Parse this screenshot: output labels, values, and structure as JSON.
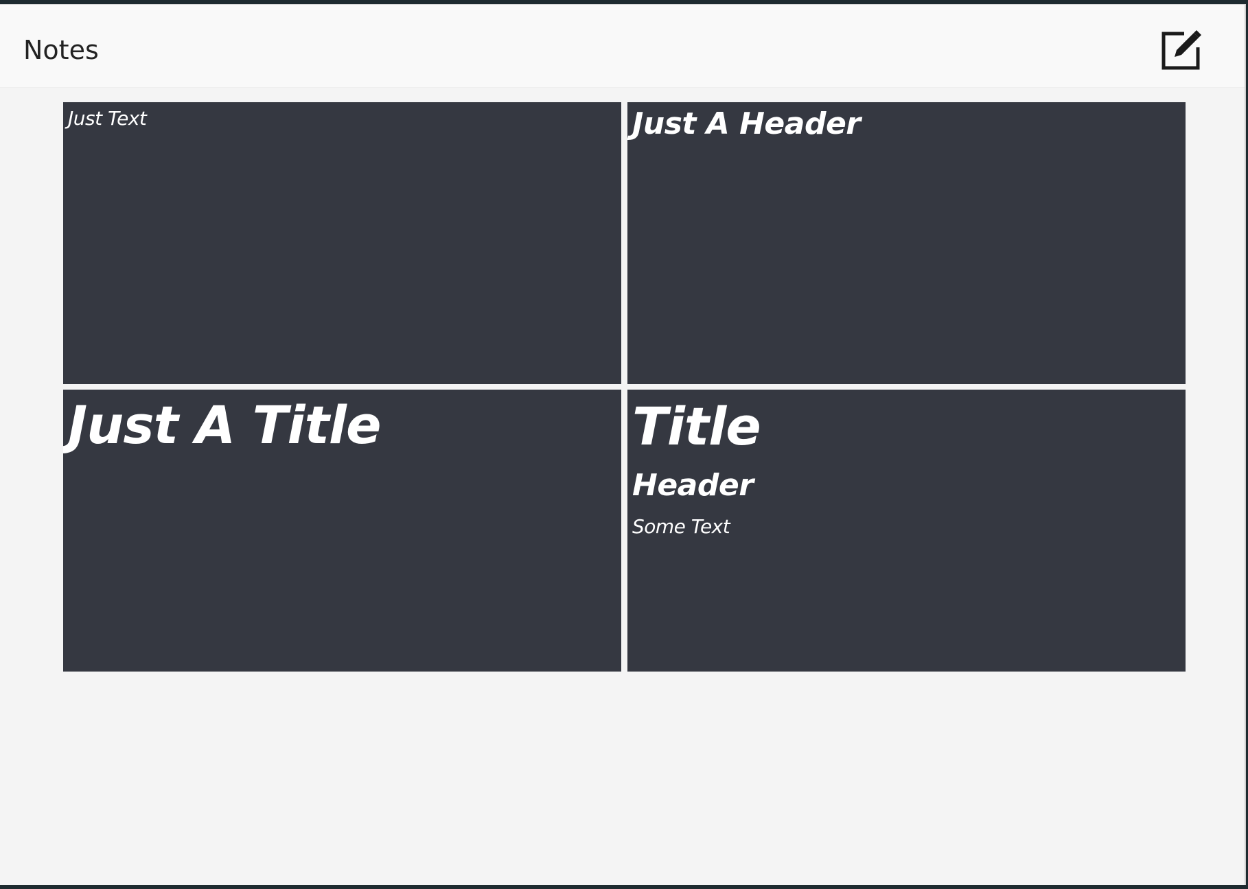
{
  "app": {
    "title": "Notes"
  },
  "toolbar": {
    "compose_icon": "compose-edit-icon"
  },
  "notes": [
    {
      "text": "Just Text"
    },
    {
      "header": "Just A Header"
    },
    {
      "title": "Just A Title"
    },
    {
      "title": "Title",
      "header": "Header",
      "text": "Some Text"
    }
  ],
  "colors": {
    "note_background": "#353841",
    "note_foreground": "#ffffff",
    "app_background": "#f4f4f4",
    "header_background": "#f9f9f9"
  }
}
